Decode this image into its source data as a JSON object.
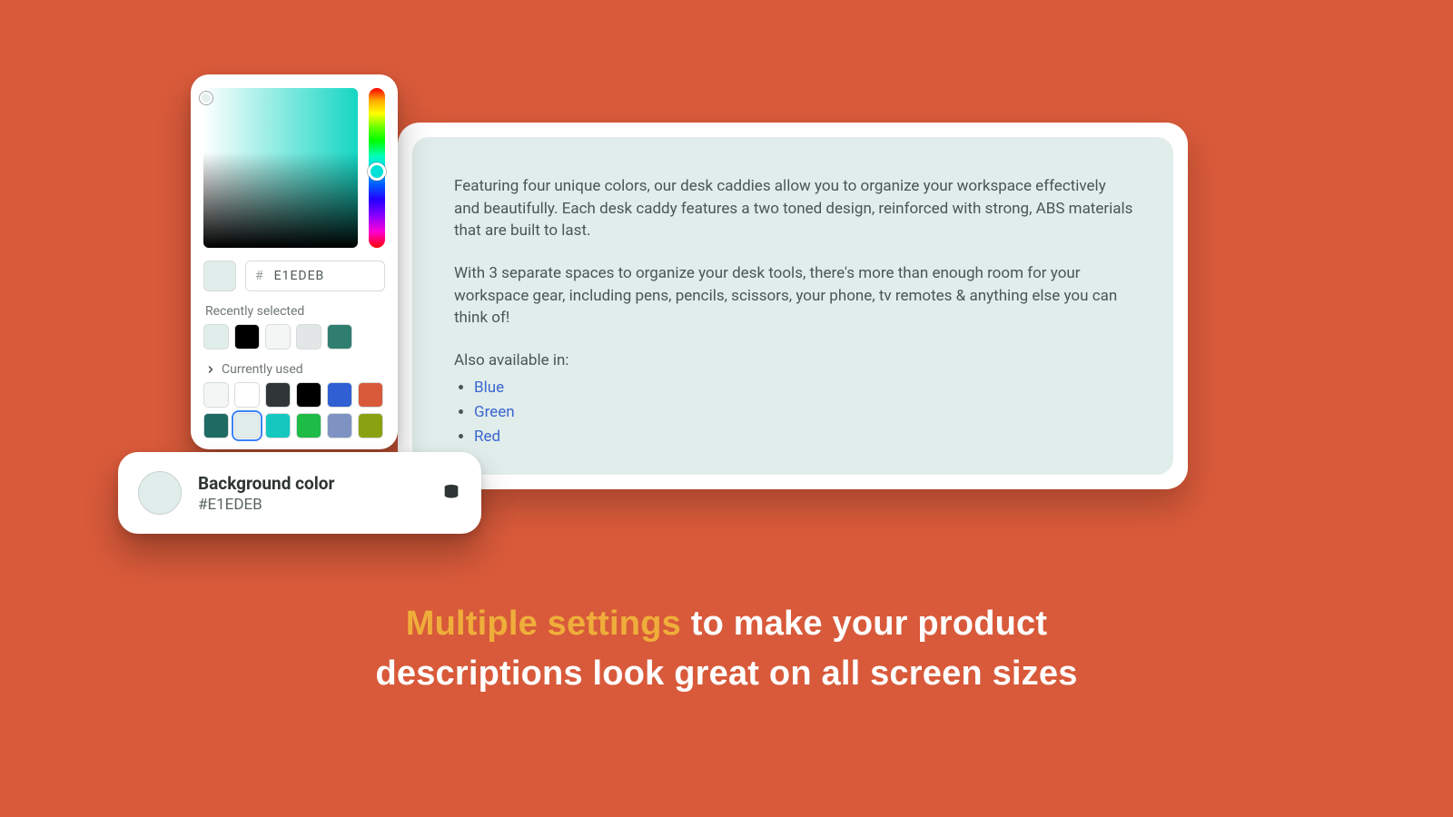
{
  "picker": {
    "hex_prefix": "#",
    "hex_value": "E1EDEB",
    "recent_label": "Recently selected",
    "recent_swatches": [
      "#E1EDEB",
      "#000000",
      "#F4F6F6",
      "#E3E6E6",
      "#2F7E70"
    ],
    "currently_used_label": "Currently used",
    "currently_used_swatches": [
      "#F4F6F6",
      "#FFFFFF",
      "#303536",
      "#000000",
      "#2F5FD3",
      "#D85A3A",
      "#1E6B63",
      "#E1EDEB",
      "#14C8BF",
      "#1EBB46",
      "#7E93C2",
      "#8AA212"
    ],
    "selected_index": 7
  },
  "setting": {
    "title": "Background color",
    "value": "#E1EDEB",
    "swatch": "#E1EDEB"
  },
  "preview": {
    "p1": "Featuring four unique colors, our desk caddies allow you to organize your workspace effectively and beautifully. Each desk caddy features a two toned design, reinforced with strong, ABS materials that are built to last.",
    "p2": "With 3 separate spaces to organize your desk tools, there's more than enough room for your workspace gear, including pens, pencils, scissors, your phone, tv remotes & anything else you can think of!",
    "also_label": "Also available in:",
    "links": [
      "Blue",
      "Green",
      "Red"
    ]
  },
  "tagline": {
    "highlight": "Multiple settings",
    "rest_line1": " to make your product",
    "line2": "descriptions look great on all screen sizes"
  }
}
